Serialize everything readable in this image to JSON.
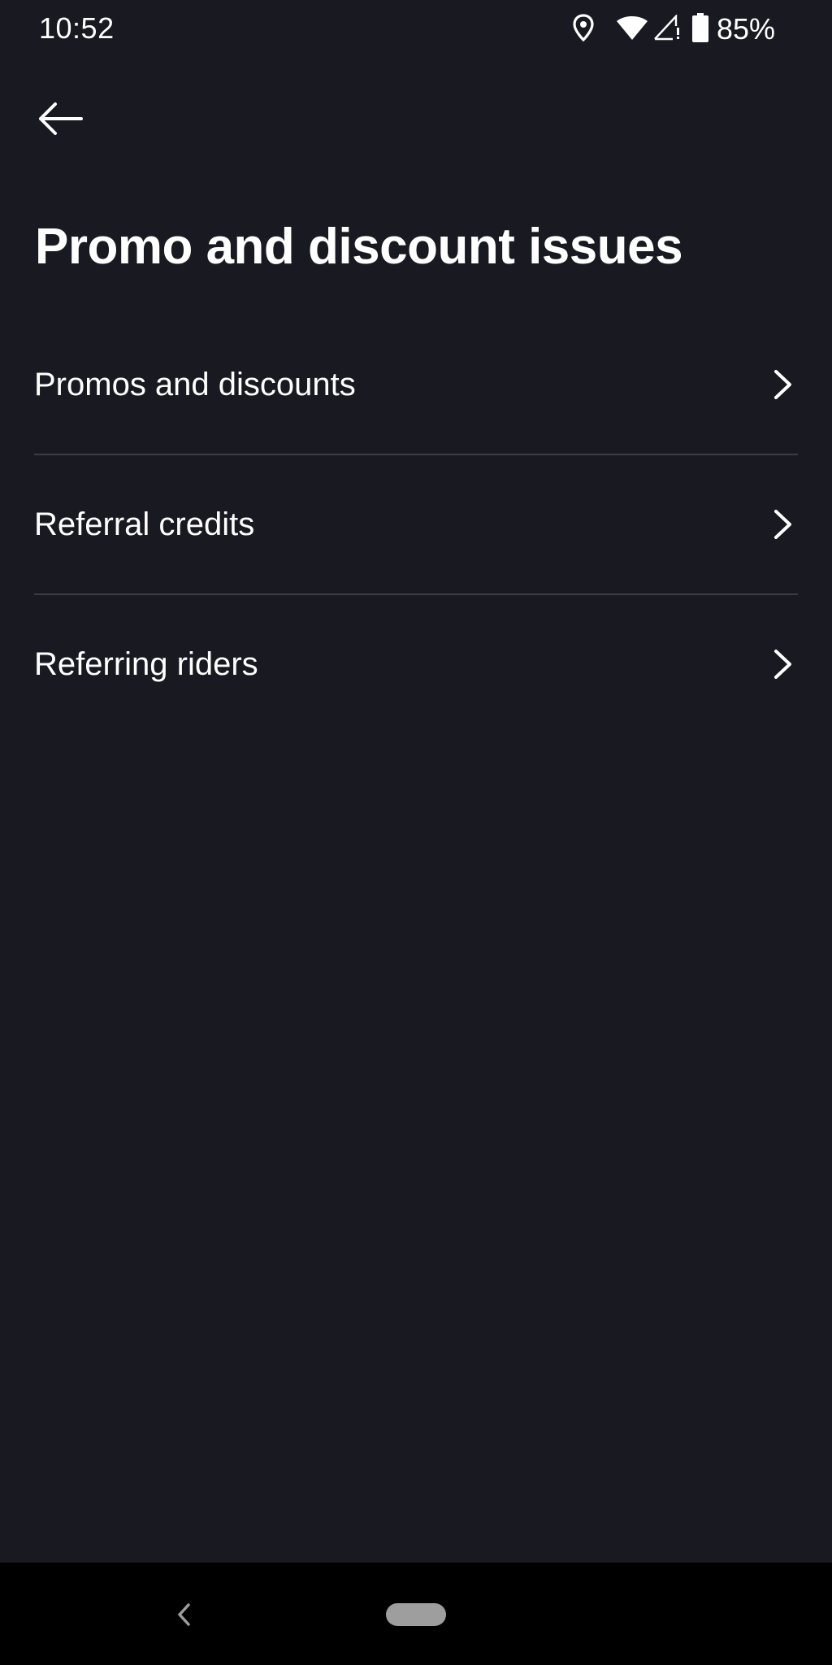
{
  "status_bar": {
    "time": "10:52",
    "battery_percent": "85%",
    "icons": [
      "location-icon",
      "wifi-icon",
      "cell-signal-icon",
      "battery-icon"
    ]
  },
  "header": {
    "back_icon": "arrow-left-icon",
    "title": "Promo and discount issues"
  },
  "menu": {
    "items": [
      {
        "label": "Promos and discounts",
        "icon": "chevron-right-icon"
      },
      {
        "label": "Referral credits",
        "icon": "chevron-right-icon"
      },
      {
        "label": "Referring riders",
        "icon": "chevron-right-icon"
      }
    ]
  },
  "colors": {
    "background": "#191921",
    "divider": "#3c3d45",
    "text": "#ffffff",
    "nav_bar": "#000000"
  }
}
